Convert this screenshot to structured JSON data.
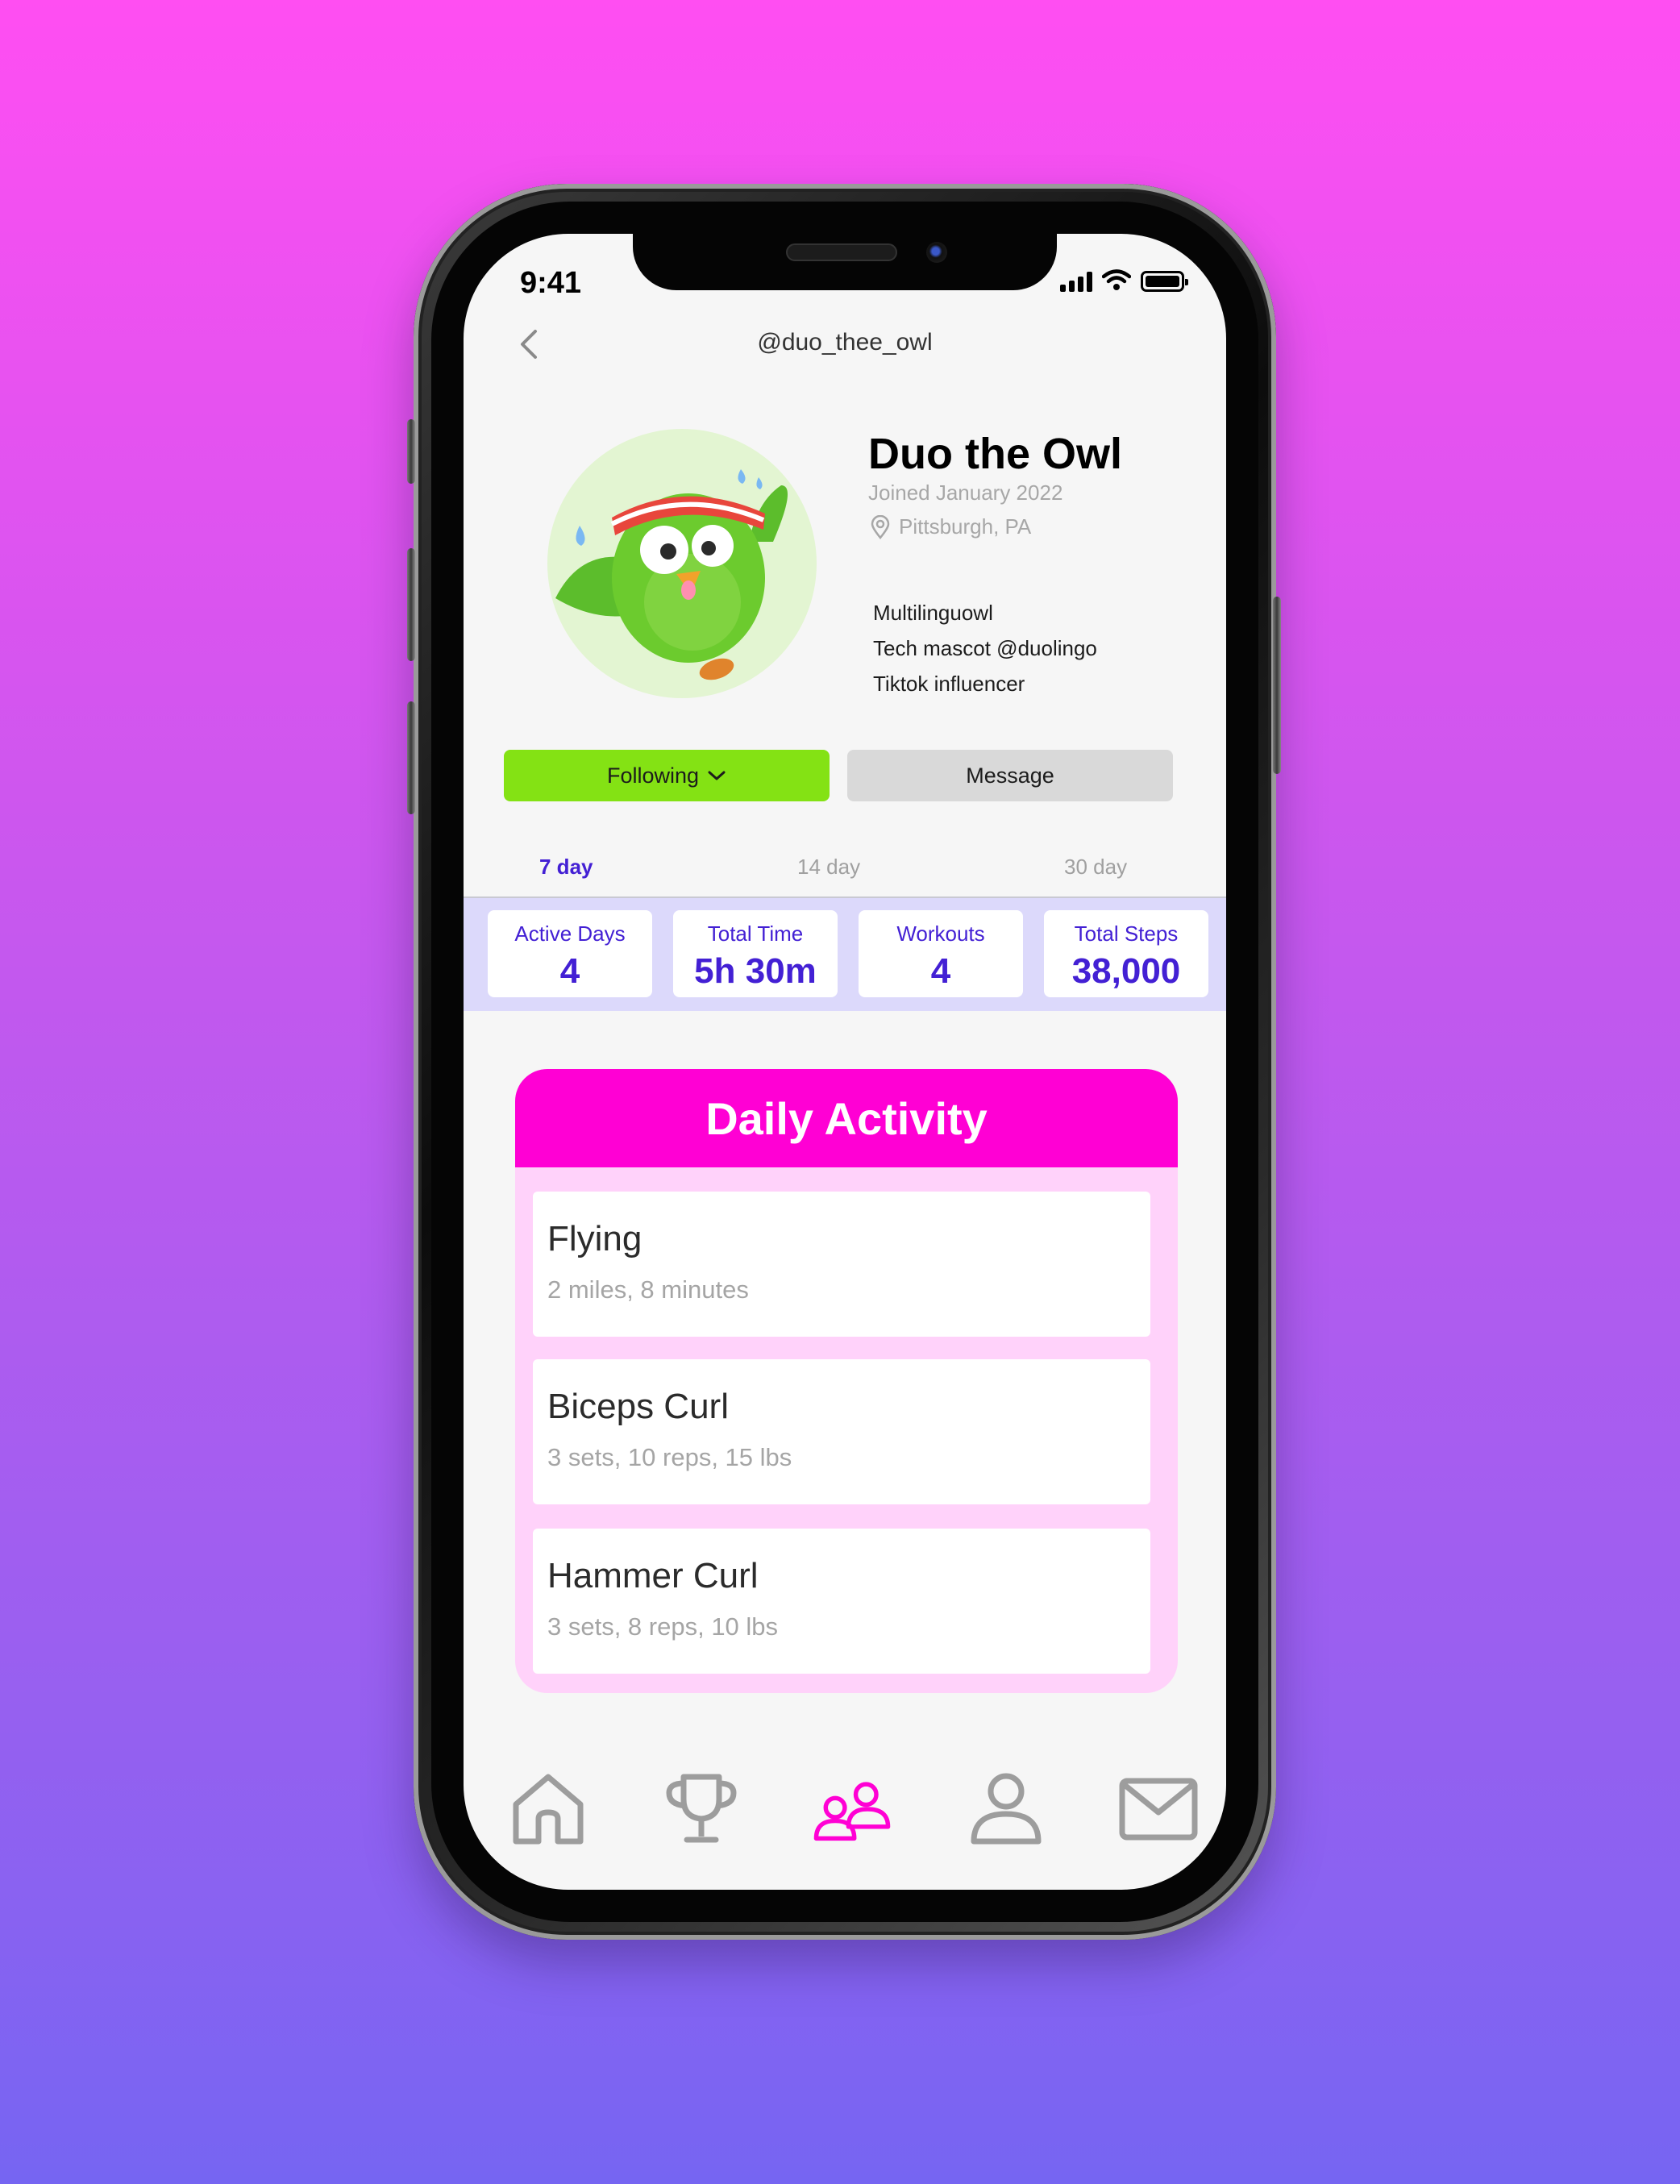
{
  "status_bar": {
    "time": "9:41"
  },
  "header": {
    "handle": "@duo_thee_owl"
  },
  "profile": {
    "name": "Duo the Owl",
    "joined": "Joined January 2022",
    "location": "Pittsburgh, PA",
    "bio": [
      "Multilinguowl",
      "Tech mascot @duolingo",
      "Tiktok influencer"
    ]
  },
  "actions": {
    "following_label": "Following",
    "message_label": "Message"
  },
  "period_tabs": [
    {
      "label": "7 day",
      "active": true
    },
    {
      "label": "14 day",
      "active": false
    },
    {
      "label": "30 day",
      "active": false
    }
  ],
  "stats": [
    {
      "label": "Active Days",
      "value": "4"
    },
    {
      "label": "Total Time",
      "value": "5h 30m"
    },
    {
      "label": "Workouts",
      "value": "4"
    },
    {
      "label": "Total Steps",
      "value": "38,000"
    }
  ],
  "daily_activity": {
    "title": "Daily Activity",
    "items": [
      {
        "name": "Flying",
        "detail": "2 miles, 8 minutes"
      },
      {
        "name": "Biceps Curl",
        "detail": "3 sets, 10 reps, 15 lbs"
      },
      {
        "name": "Hammer Curl",
        "detail": "3 sets, 8 reps, 10 lbs"
      }
    ]
  },
  "tab_bar": [
    {
      "icon": "home-icon",
      "active": false
    },
    {
      "icon": "trophy-icon",
      "active": false
    },
    {
      "icon": "friends-icon",
      "active": true
    },
    {
      "icon": "profile-icon",
      "active": false
    },
    {
      "icon": "mail-icon",
      "active": false
    }
  ],
  "colors": {
    "accent_purple": "#4320d4",
    "accent_magenta": "#ff00d4",
    "following_green": "#84e214",
    "stats_band": "#dcd9fb",
    "activity_panel": "#ffd2fa",
    "inactive_icon": "#9d9d9d"
  }
}
